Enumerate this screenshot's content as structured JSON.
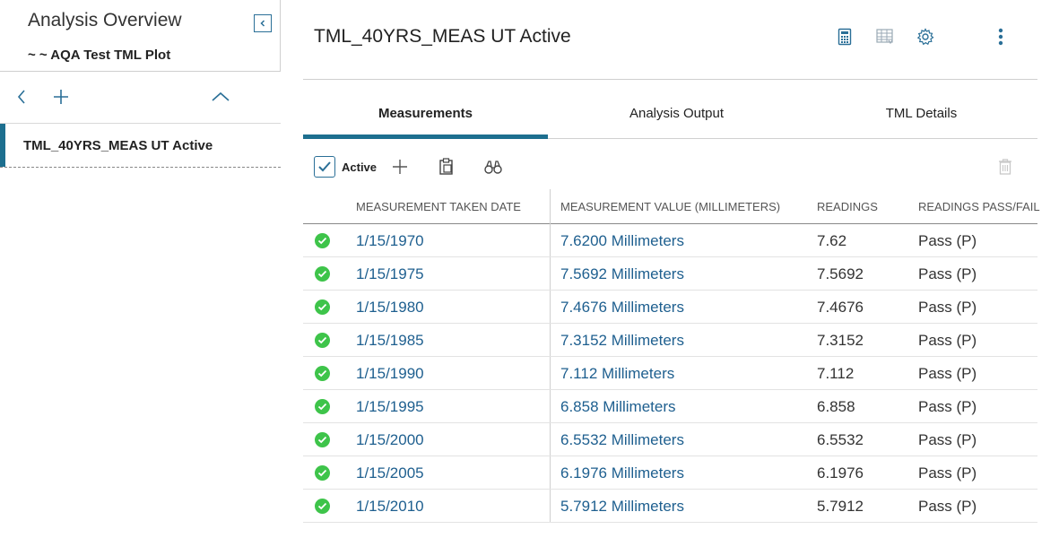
{
  "left_pane": {
    "title": "Analysis Overview",
    "subtitle": "~ ~ AQA Test TML Plot",
    "item": {
      "label": "TML_40YRS_MEAS UT Active"
    }
  },
  "right_pane": {
    "title": "TML_40YRS_MEAS UT Active",
    "header_icons": [
      "calculator-icon",
      "table-icon",
      "gear-icon",
      "more-vertical-icon"
    ],
    "tabs": [
      {
        "label": "Measurements",
        "active": true
      },
      {
        "label": "Analysis Output",
        "active": false
      },
      {
        "label": "TML Details",
        "active": false
      }
    ],
    "toolbar": {
      "active_label": "Active",
      "active_checked": true
    },
    "table": {
      "headers": [
        "MEASUREMENT TAKEN DATE",
        "MEASUREMENT VALUE (MILLIMETERS)",
        "READINGS",
        "READINGS PASS/FAIL"
      ],
      "rows": [
        {
          "date": "1/15/1970",
          "value": "7.6200 Millimeters",
          "readings": "7.62",
          "pass_fail": "Pass (P)"
        },
        {
          "date": "1/15/1975",
          "value": "7.5692 Millimeters",
          "readings": "7.5692",
          "pass_fail": "Pass (P)"
        },
        {
          "date": "1/15/1980",
          "value": "7.4676 Millimeters",
          "readings": "7.4676",
          "pass_fail": "Pass (P)"
        },
        {
          "date": "1/15/1985",
          "value": "7.3152 Millimeters",
          "readings": "7.3152",
          "pass_fail": "Pass (P)"
        },
        {
          "date": "1/15/1990",
          "value": "7.112 Millimeters",
          "readings": "7.112",
          "pass_fail": "Pass (P)"
        },
        {
          "date": "1/15/1995",
          "value": "6.858 Millimeters",
          "readings": "6.858",
          "pass_fail": "Pass (P)"
        },
        {
          "date": "1/15/2000",
          "value": "6.5532 Millimeters",
          "readings": "6.5532",
          "pass_fail": "Pass (P)"
        },
        {
          "date": "1/15/2005",
          "value": "6.1976 Millimeters",
          "readings": "6.1976",
          "pass_fail": "Pass (P)"
        },
        {
          "date": "1/15/2010",
          "value": "5.7912 Millimeters",
          "readings": "5.7912",
          "pass_fail": "Pass (P)"
        }
      ]
    }
  },
  "colors": {
    "accent": "#1d6f8f",
    "link": "#1e5f8f",
    "status_ok": "#3ec44a"
  }
}
